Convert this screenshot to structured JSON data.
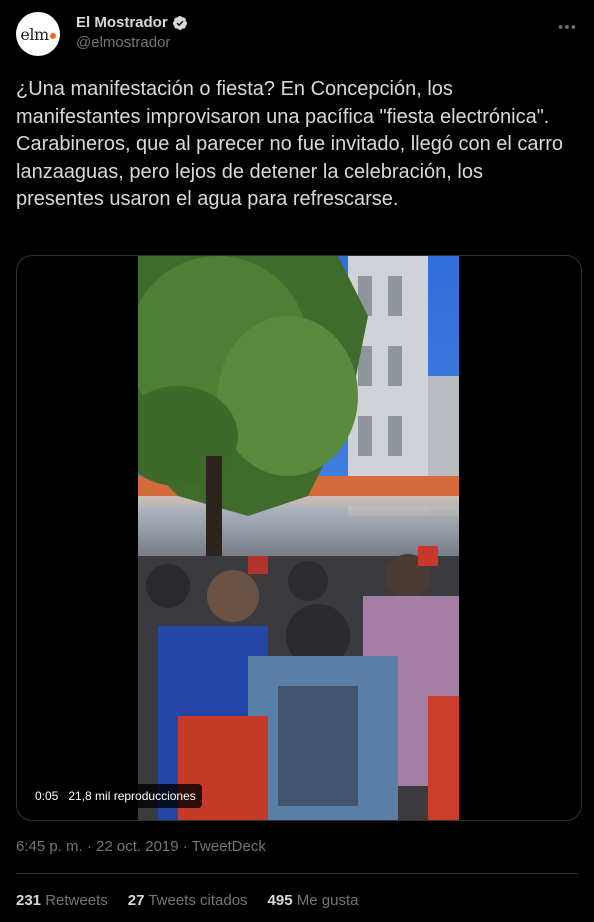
{
  "author": {
    "display_name": "El Mostrador",
    "handle": "@elmostrador",
    "avatar_text": "elm"
  },
  "tweet": {
    "text": "¿Una manifestación o fiesta? En Concepción, los manifestantes improvisaron una pacífica \"fiesta electrónica\". Carabineros, que al parecer no fue invitado, llegó con el carro lanzaaguas, pero lejos de detener la celebración, los presentes usaron el agua para refrescarse."
  },
  "video": {
    "time": "0:05",
    "views": "21,8 mil reproducciones"
  },
  "meta": {
    "timestamp": "6:45 p. m. · 22 oct. 2019 · TweetDeck"
  },
  "stats": {
    "retweets_count": "231",
    "retweets_label": "Retweets",
    "quotes_count": "27",
    "quotes_label": "Tweets citados",
    "likes_count": "495",
    "likes_label": "Me gusta"
  },
  "colors": {
    "background": "#000000",
    "text": "#d9d9d9",
    "secondary": "#6e767d",
    "border": "#2f3336",
    "verified": "#d9d9d9",
    "brand_dot": "#f26522"
  },
  "icons": {
    "verified": "verified-badge-icon",
    "more": "more-options-icon"
  }
}
